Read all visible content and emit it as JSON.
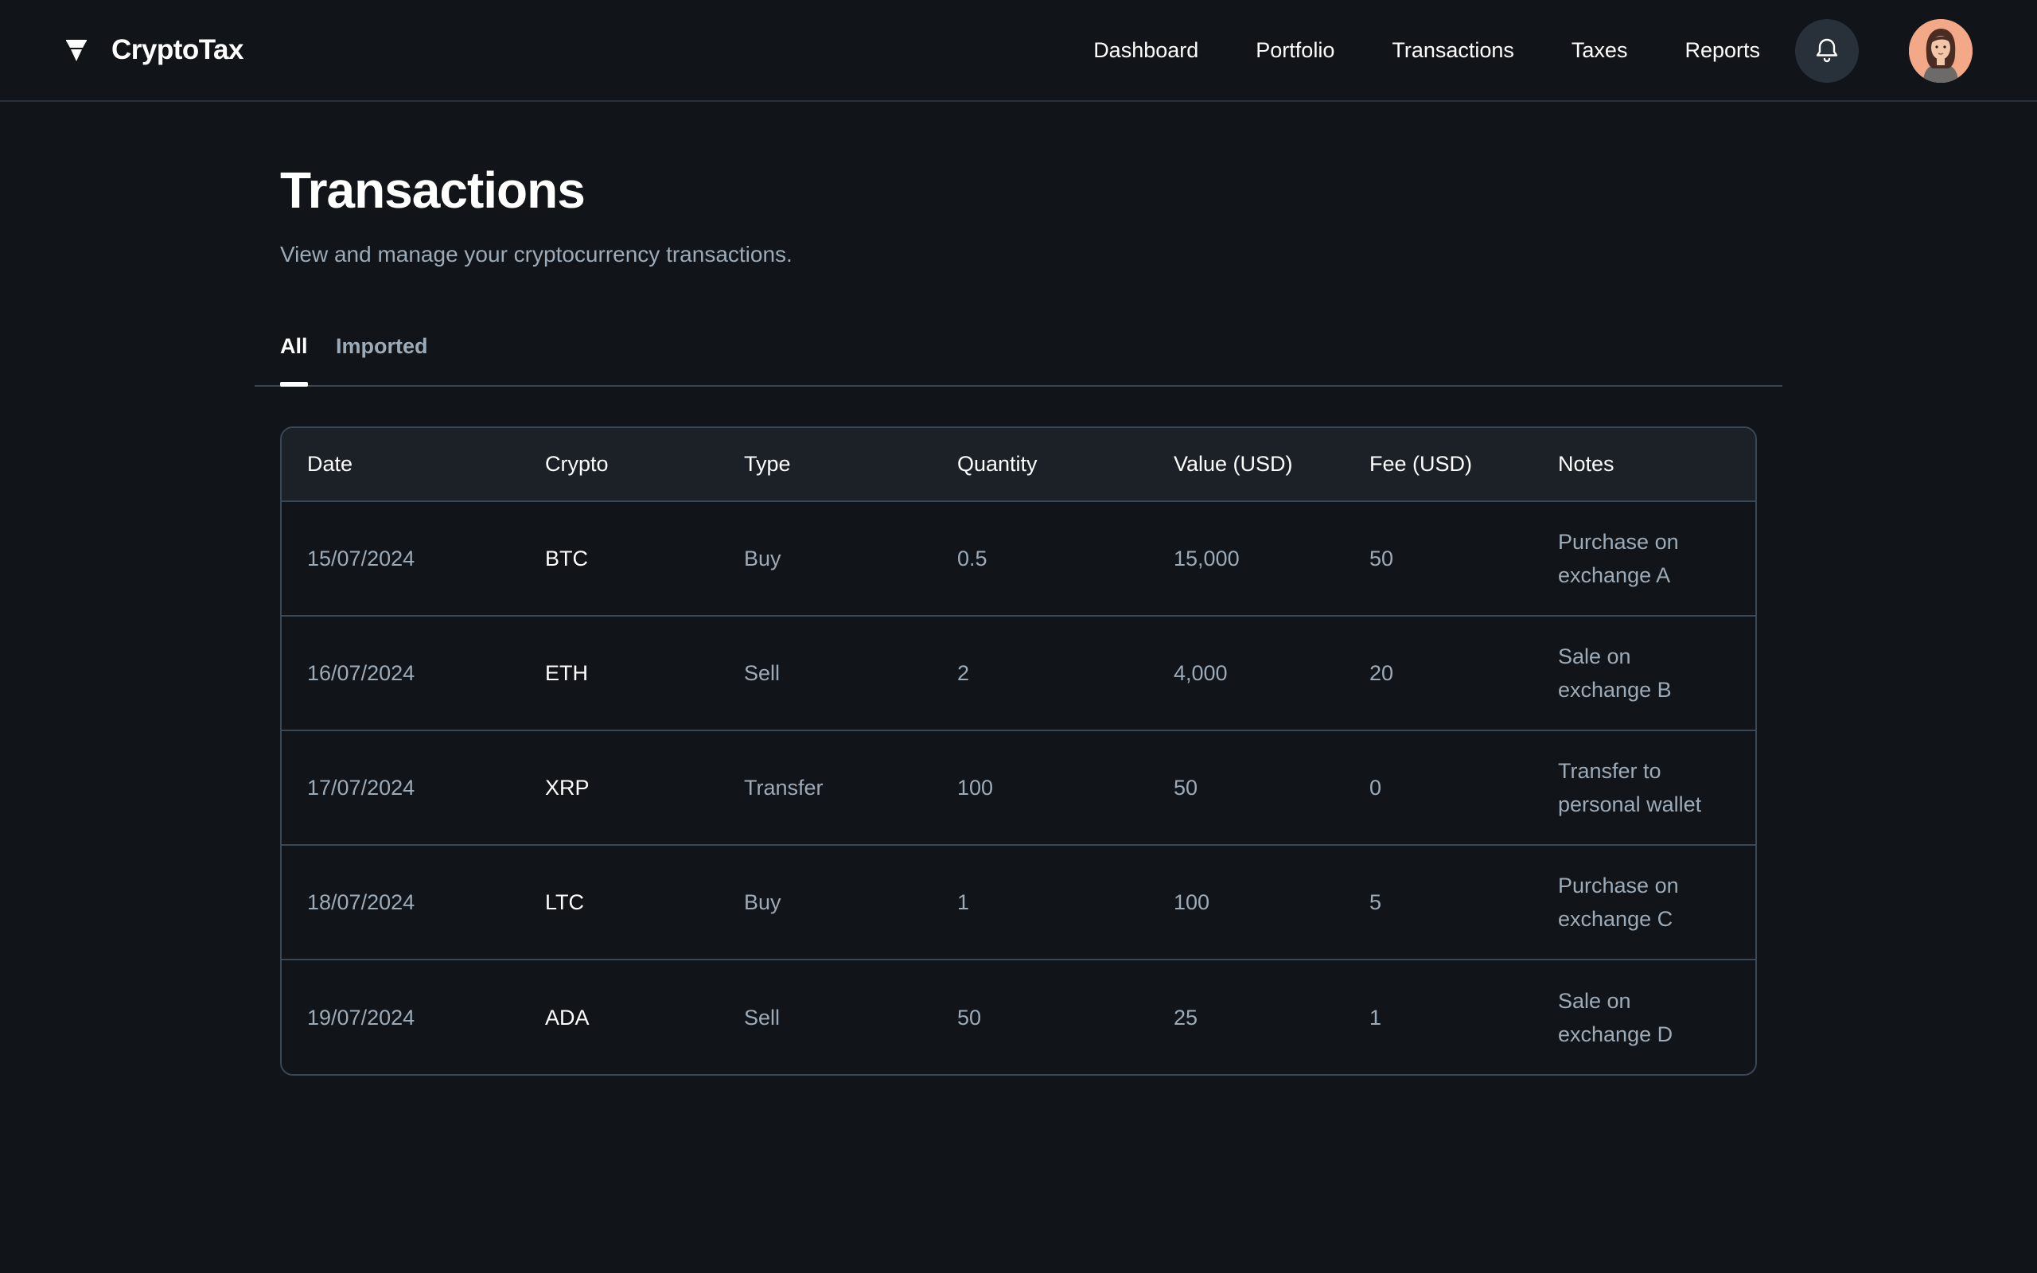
{
  "header": {
    "brand_name": "CryptoTax",
    "brand_icon": "tornado-logo-icon",
    "nav": [
      {
        "label": "Dashboard"
      },
      {
        "label": "Portfolio"
      },
      {
        "label": "Transactions"
      },
      {
        "label": "Taxes"
      },
      {
        "label": "Reports"
      }
    ],
    "notification_icon": "bell-icon",
    "avatar_icon": "user-avatar"
  },
  "page": {
    "title": "Transactions",
    "subtitle": "View and manage your cryptocurrency transactions."
  },
  "tabs": [
    {
      "label": "All",
      "active": true
    },
    {
      "label": "Imported",
      "active": false
    }
  ],
  "table": {
    "columns": [
      "Date",
      "Crypto",
      "Type",
      "Quantity",
      "Value (USD)",
      "Fee (USD)",
      "Notes"
    ],
    "rows": [
      {
        "date": "15/07/2024",
        "crypto": "BTC",
        "type": "Buy",
        "quantity": "0.5",
        "value": "15,000",
        "fee": "50",
        "notes": "Purchase on exchange A"
      },
      {
        "date": "16/07/2024",
        "crypto": "ETH",
        "type": "Sell",
        "quantity": "2",
        "value": "4,000",
        "fee": "20",
        "notes": "Sale on exchange B"
      },
      {
        "date": "17/07/2024",
        "crypto": "XRP",
        "type": "Transfer",
        "quantity": "100",
        "value": "50",
        "fee": "0",
        "notes": "Transfer to personal wallet"
      },
      {
        "date": "18/07/2024",
        "crypto": "LTC",
        "type": "Buy",
        "quantity": "1",
        "value": "100",
        "fee": "5",
        "notes": "Purchase on exchange C"
      },
      {
        "date": "19/07/2024",
        "crypto": "ADA",
        "type": "Sell",
        "quantity": "50",
        "value": "25",
        "fee": "1",
        "notes": "Sale on exchange D"
      }
    ]
  },
  "colors": {
    "background": "#111418",
    "header_row": "#1b2127",
    "border": "#3b4754",
    "muted_text": "#9dabb8",
    "text": "#ffffff"
  }
}
